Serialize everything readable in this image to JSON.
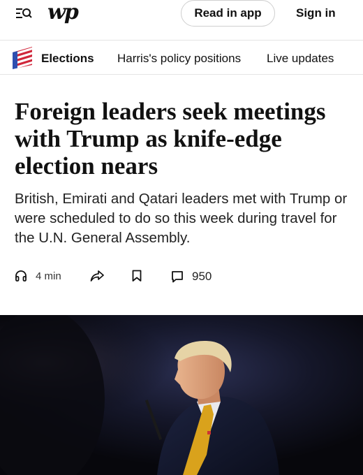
{
  "header": {
    "logo_text": "wp",
    "read_in_app": "Read in app",
    "sign_in": "Sign in"
  },
  "section_nav": {
    "section": "Elections",
    "links": [
      "Harris's policy positions",
      "Live updates"
    ]
  },
  "article": {
    "headline": "Foreign leaders seek meetings with Trump as knife-edge election nears",
    "dek": "British, Emirati and Qatari leaders met with Trump or were scheduled to do so this week during travel for the U.N. General Assembly.",
    "listen_time": "4 min",
    "comment_count": "950"
  },
  "icons": [
    "menu-search-icon",
    "flag-icon",
    "headphones-icon",
    "share-icon",
    "bookmark-icon",
    "comment-icon"
  ],
  "colors": {
    "flag_blue": "#2f4fb0",
    "flag_red": "#d0263a",
    "tie_gold": "#d9a21c",
    "photo_bg": "#0c0c14"
  }
}
